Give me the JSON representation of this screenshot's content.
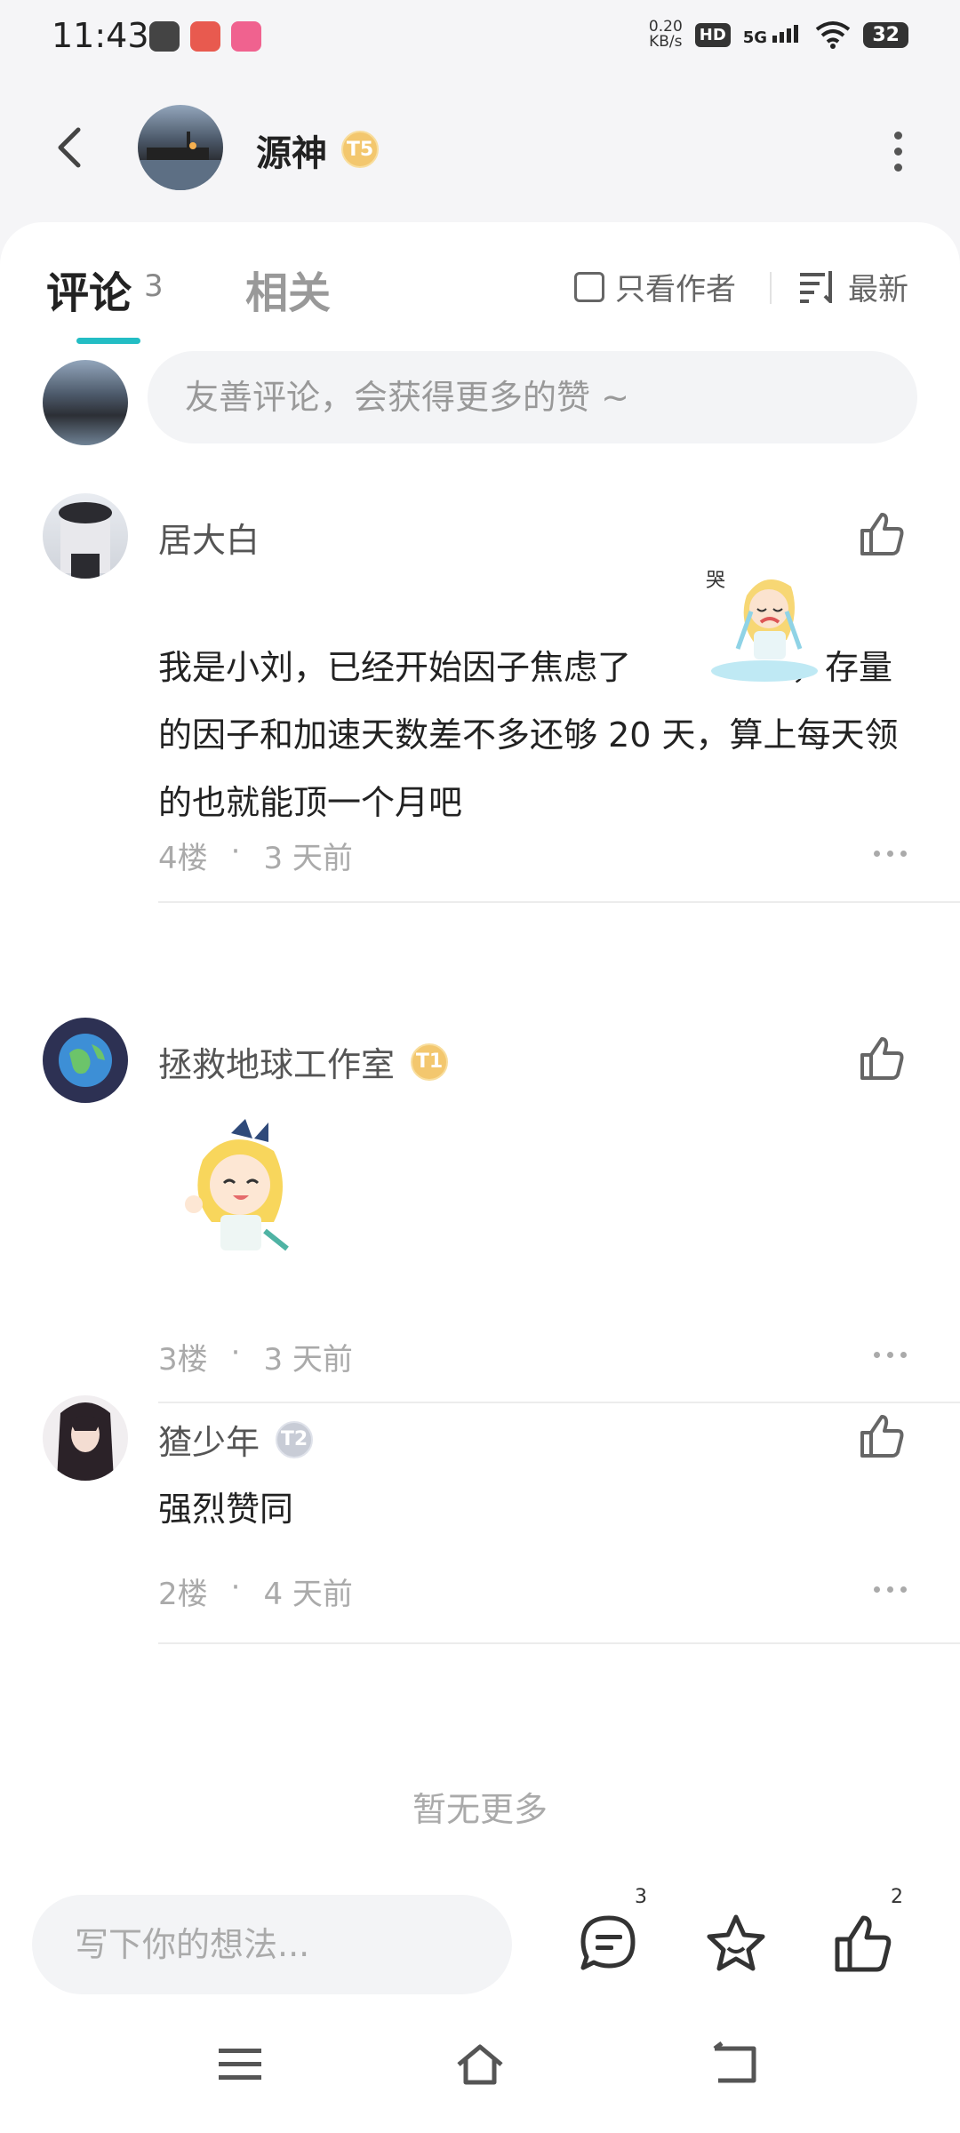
{
  "status": {
    "time": "11:43",
    "net_speed_value": "0.20",
    "net_speed_unit": "KB/s",
    "hd": "HD",
    "network": "5G",
    "battery": "32"
  },
  "header": {
    "title": "源神",
    "badge": "T5"
  },
  "tabs": {
    "comments_label": "评论",
    "comments_count": "3",
    "related_label": "相关",
    "author_only_label": "只看作者",
    "sort_label": "最新"
  },
  "comment_input": {
    "placeholder": "友善评论，会获得更多的赞 ~"
  },
  "comments": [
    {
      "user": "居大白",
      "text_before": "我是小刘，已经开始因子焦虑了",
      "text_after": "，存量的因子和加速天数差不多还够 20 天，算上每天领的也就能顶一个月吧",
      "floor": "4楼",
      "time": "3 天前"
    },
    {
      "user": "拯救地球工作室",
      "badge": "T1",
      "floor": "3楼",
      "time": "3 天前"
    },
    {
      "user": "猹少年",
      "badge": "T2",
      "text": "强烈赞同",
      "floor": "2楼",
      "time": "4 天前"
    }
  ],
  "footer": {
    "no_more": "暂无更多"
  },
  "bottom_bar": {
    "placeholder": "写下你的想法...",
    "comment_count": "3",
    "like_count": "2"
  },
  "colors": {
    "accent": "#23bdc4",
    "badge_gold": "#f3c76e",
    "badge_silver": "#c8ccd6"
  }
}
